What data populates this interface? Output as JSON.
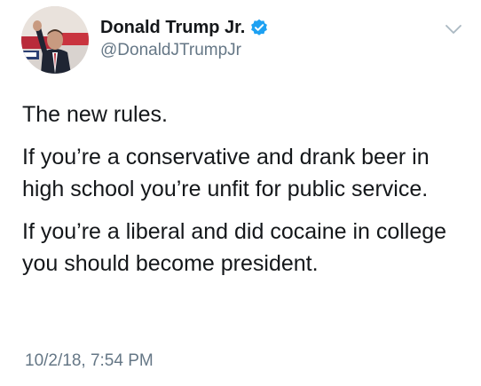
{
  "author": {
    "display_name": "Donald Trump Jr.",
    "handle": "@DonaldJTrumpJr",
    "verified": true
  },
  "icons": {
    "verified": "verified-badge-icon",
    "menu": "chevron-down-icon"
  },
  "tweet": {
    "paragraphs": [
      "The new rules.",
      "If you’re a conservative and drank beer in high school you’re unfit for public service.",
      "If you’re a liberal and did cocaine in college you should become president."
    ],
    "timestamp": "10/2/18, 7:54 PM"
  },
  "colors": {
    "text": "#14171a",
    "secondary_text": "#657786",
    "verified_blue": "#1da1f2",
    "chevron": "#aab8c2"
  }
}
